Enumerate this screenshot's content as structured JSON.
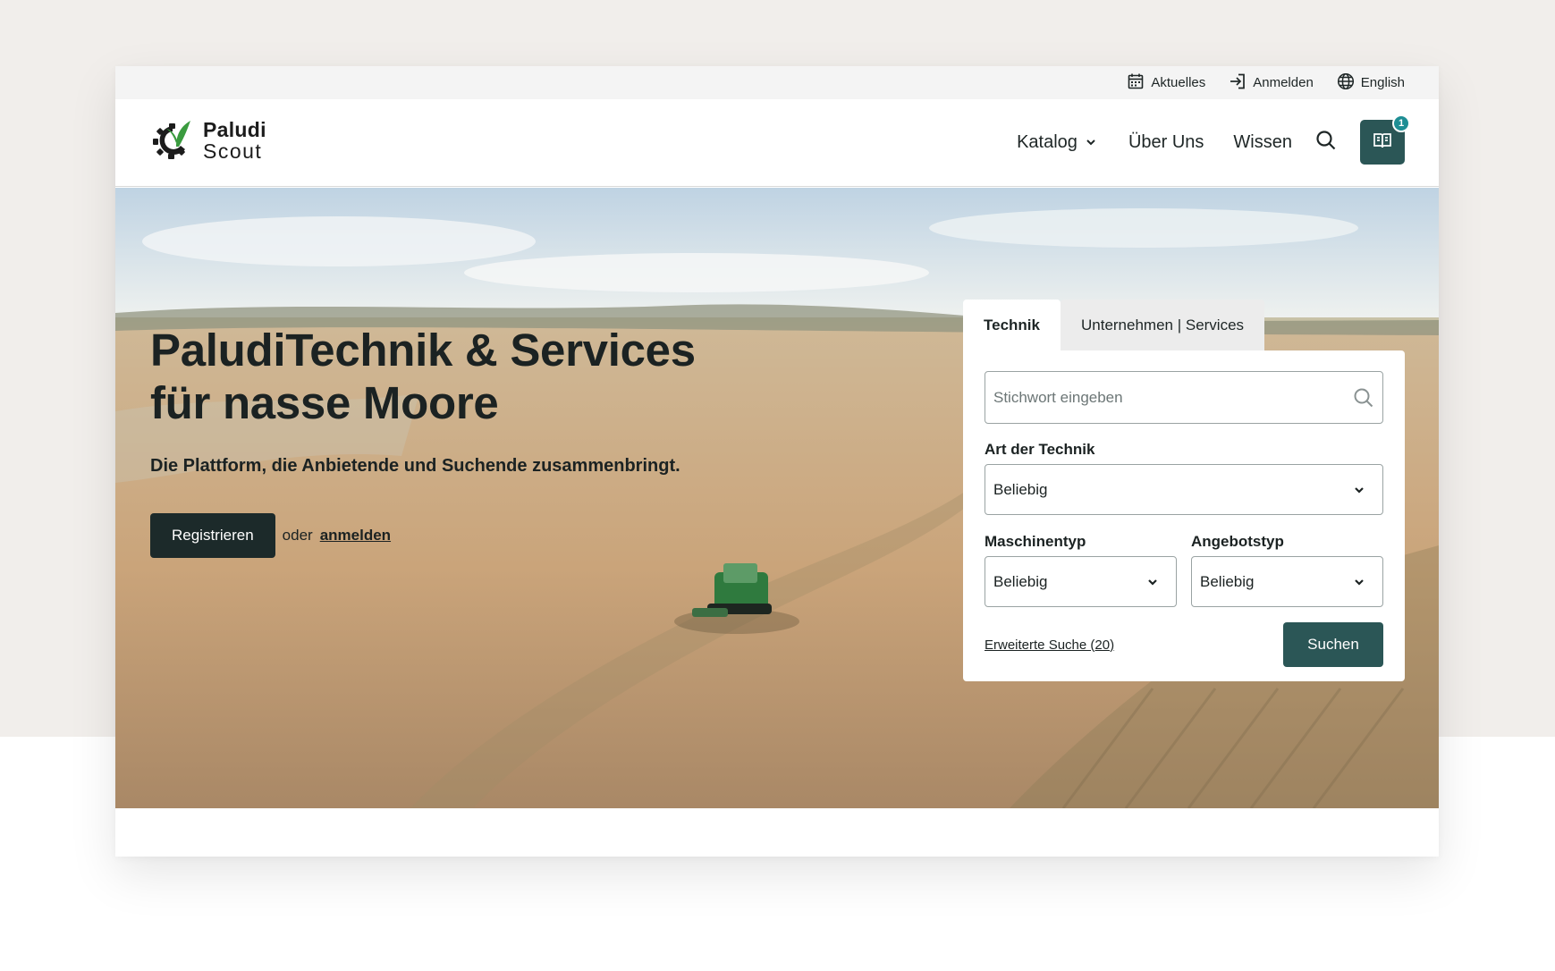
{
  "colors": {
    "page_background": "#f1eeeb",
    "primary_teal": "#2b5656",
    "badge_teal": "#1e8e94",
    "dark_button": "#1c2a2a",
    "logo_green": "#3a9b3f"
  },
  "utility_bar": {
    "news": {
      "label": "Aktuelles",
      "icon": "calendar-icon"
    },
    "login": {
      "label": "Anmelden",
      "icon": "login-icon"
    },
    "language": {
      "label": "English",
      "icon": "globe-icon"
    }
  },
  "brand": {
    "name_line1": "Paludi",
    "name_line2": "Scout"
  },
  "nav": {
    "items": [
      {
        "label": "Katalog",
        "has_dropdown": true
      },
      {
        "label": "Über Uns"
      },
      {
        "label": "Wissen"
      }
    ],
    "search_icon": "search-icon",
    "compare": {
      "icon": "book-compare-icon",
      "badge_count": "1"
    }
  },
  "hero": {
    "title": "PaludiTechnik & Services für nasse Moore",
    "subtitle": "Die Plattform, die Anbietende und Suchende zusammenbringt.",
    "register_label": "Registrieren",
    "or_text": "oder",
    "login_link": "anmelden"
  },
  "search": {
    "tabs": [
      {
        "label": "Technik",
        "active": true
      },
      {
        "label": "Unternehmen | Services",
        "active": false
      }
    ],
    "keyword_placeholder": "Stichwort eingeben",
    "art_label": "Art der Technik",
    "art_value": "Beliebig",
    "machine_label": "Maschinentyp",
    "machine_value": "Beliebig",
    "offer_label": "Angebotstyp",
    "offer_value": "Beliebig",
    "advanced_link": "Erweiterte Suche (20)",
    "submit_label": "Suchen"
  }
}
